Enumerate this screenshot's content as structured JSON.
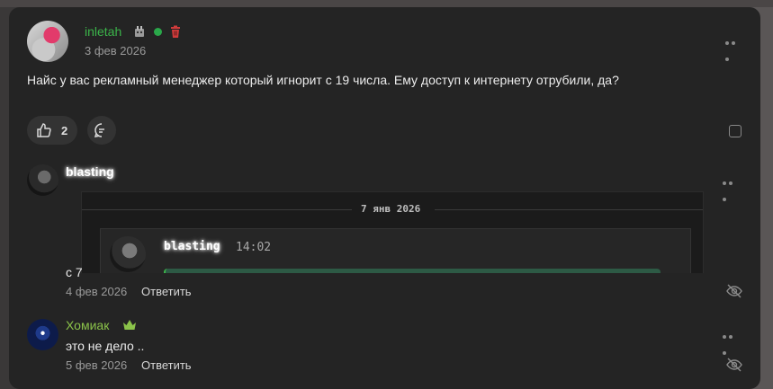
{
  "post": {
    "author": "inletah",
    "date": "3 фев 2026",
    "text": "Найс у вас рекламный менеджер который игнорит с 19 числа. Ему доступ к интернету отрубили, да?",
    "like_count": "2"
  },
  "comments": [
    {
      "author": "blasting",
      "embed": {
        "date_divider": "7 янв 2026",
        "author": "blasting",
        "time": "14:02"
      },
      "text": "с 7",
      "date": "4 фев 2026",
      "reply_label": "Ответить"
    },
    {
      "author": "Хомиак",
      "text": "это не дело ..",
      "date": "5 фев 2026",
      "reply_label": "Ответить"
    }
  ],
  "colors": {
    "online": "#2aa84a",
    "username_green": "#3bb44a",
    "delete_red": "#d03b3b",
    "crown": "#8bc34a"
  }
}
